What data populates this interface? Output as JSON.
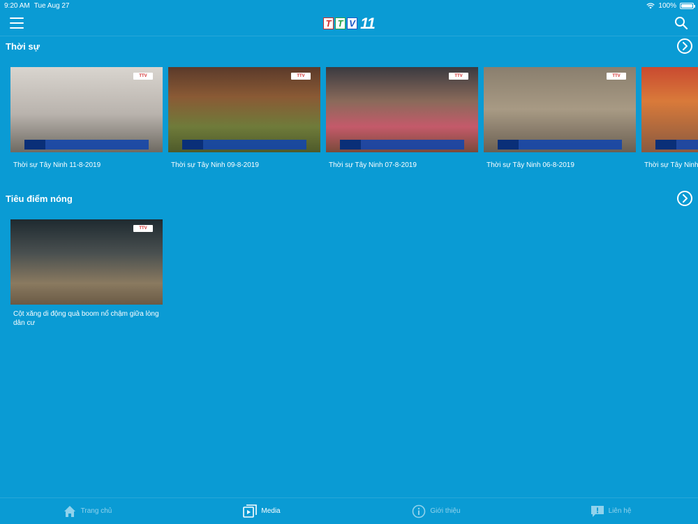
{
  "status": {
    "time": "9:20 AM",
    "date": "Tue Aug 27",
    "battery": "100%"
  },
  "nav": {
    "logo_letters": [
      "T",
      "T",
      "V"
    ],
    "logo_number": "11"
  },
  "sections": [
    {
      "title": "Thời sự",
      "cards": [
        {
          "title": "Thời sự Tây Ninh 11-8-2019"
        },
        {
          "title": "Thời sự Tây Ninh 09-8-2019"
        },
        {
          "title": "Thời sự Tây Ninh 07-8-2019"
        },
        {
          "title": "Thời sự Tây Ninh 06-8-2019"
        },
        {
          "title": "Thời sự Tây Ninh"
        }
      ]
    },
    {
      "title": "Tiêu điểm nóng",
      "cards": [
        {
          "title": "Cột xăng di động quả boom nổ chậm giữa lòng dân cư"
        }
      ]
    }
  ],
  "tabs": [
    {
      "label": "Trang chủ",
      "icon": "home-icon"
    },
    {
      "label": "Media",
      "icon": "media-icon"
    },
    {
      "label": "Giới thiệu",
      "icon": "info-icon"
    },
    {
      "label": "Liên hệ",
      "icon": "chat-icon"
    }
  ],
  "colors": {
    "background": "#0a9bd4",
    "text": "#ffffff"
  }
}
